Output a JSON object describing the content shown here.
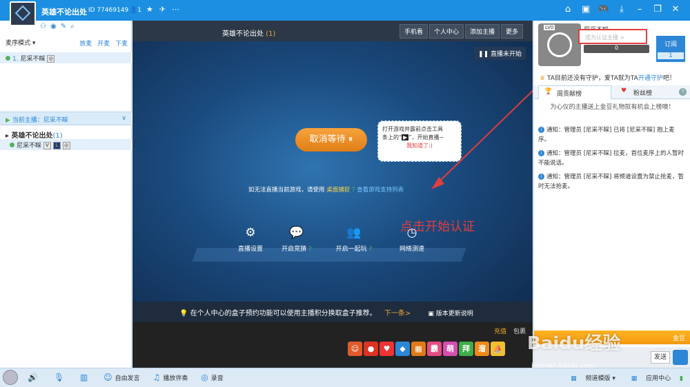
{
  "window": {
    "title": "英雄不论出处",
    "room_id": "ID 77469149",
    "user_count": "1"
  },
  "left": {
    "mic_mode": "麦序模式",
    "mic_actions": [
      "放麦",
      "开麦",
      "下麦"
    ],
    "queue_item": {
      "index": "1.",
      "name": "尼采不睬"
    },
    "current_host": "当前主播：尼采不睬",
    "channel": {
      "name": "英雄不论出处",
      "count": "(1)"
    },
    "member": "尼采不睬"
  },
  "stream": {
    "title": "英雄不论出处",
    "title_count": "(1)",
    "top_buttons": [
      "手机看",
      "个人中心",
      "添加主播",
      "更多"
    ],
    "status": "直播未开始",
    "cancel_label": "取消等待",
    "tip_line1": "打开游戏并露前点击工具",
    "tip_line2": "条上的“",
    "tip_line2b": "”，开始直播~",
    "tip_ok": "我知道了:)",
    "hint_prefix": "如无法直播当前游戏，请使用",
    "hint_link": "桌面捕捉",
    "hint_list": "查看游戏支持列表",
    "annotation": "点击开始认证",
    "tools": [
      "直播设置",
      "开启竞猜",
      "开启一起玩",
      "网络测速"
    ],
    "tip_bar": "在个人中心的盒子预约功能可以使用主播积分换取盒子推荐。",
    "tip_next": "下一条>",
    "tip_update": "版本更新说明",
    "recharge": "充值",
    "package": "包裹",
    "gifts": [
      "霸",
      "萌",
      "拜",
      "溜"
    ]
  },
  "right": {
    "level": "LV0",
    "host_name": "尼采不睬",
    "verify_placeholder": "成为认证主播 >",
    "fans_value": "0",
    "subscribe_label": "订阅",
    "subscribe_count": "1",
    "guard_text": "TA目前还没有守护，爱TA就为TA",
    "guard_link": "开通守护",
    "guard_suffix": "吧！",
    "tab_week": "周贡献榜",
    "tab_fans": "粉丝榜",
    "rank_note": "为心仪的主播送上金豆礼物就有机会上榜噢！",
    "notices": [
      "通知：管理员 [尼采不睬] 已将 [尼采不睬] 抱上麦序。",
      "通知：管理员 [尼采不睬] 拉麦，首位麦序上的人暂时不能说话。",
      "通知：管理员 [尼采不睬] 将频道设置为禁止抢麦，暂时无法抢麦。"
    ],
    "chat_bar": "金豆",
    "send_label": "发送"
  },
  "bottom": {
    "items": [
      "自由发言",
      "播放伴奏",
      "录音"
    ],
    "channel_template": "频道模版",
    "app_center": "应用中心"
  },
  "watermark": {
    "text": "Baidu经验",
    "url": "jingyan.baidu.com"
  },
  "colors": {
    "titlebar": "#1c8fe2",
    "accent": "#f0a830",
    "annotation": "#e23d3d"
  }
}
